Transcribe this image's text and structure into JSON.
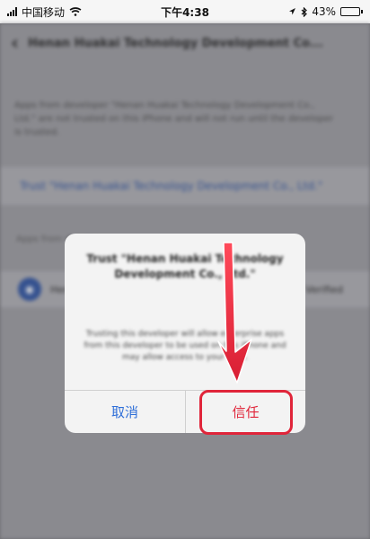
{
  "status_bar": {
    "carrier": "中国移动",
    "time": "下午4:38",
    "battery": "43%",
    "battery_level": 0.43
  },
  "nav": {
    "title": "Henan Huakai Technology Development Co..."
  },
  "page": {
    "description": "Apps from developer \"Henan Huakai Technology Development Co., Ltd.\" are not trusted on this iPhone and will not run until the developer is trusted.",
    "trust_link": "Trust \"Henan Huakai Technology Development Co., Ltd.\"",
    "section_header": "Apps from developer",
    "app_row_name": "Henan Huakai",
    "app_row_status": "Verified"
  },
  "alert": {
    "title": "Trust \"Henan Huakai Technology Development Co., Ltd.\"",
    "message": "Trusting this developer will allow enterprise apps from this developer to be used on this iPhone and may allow access to your data.",
    "cancel_label": "取消",
    "trust_label": "信任"
  },
  "colors": {
    "accent_blue": "#2f6fd8",
    "annotation_red": "#e0253a"
  },
  "icons": [
    "signal-icon",
    "wifi-icon",
    "location-icon",
    "bluetooth-icon",
    "battery-icon",
    "chevron-left-icon",
    "app-icon",
    "arrow-down-icon"
  ]
}
